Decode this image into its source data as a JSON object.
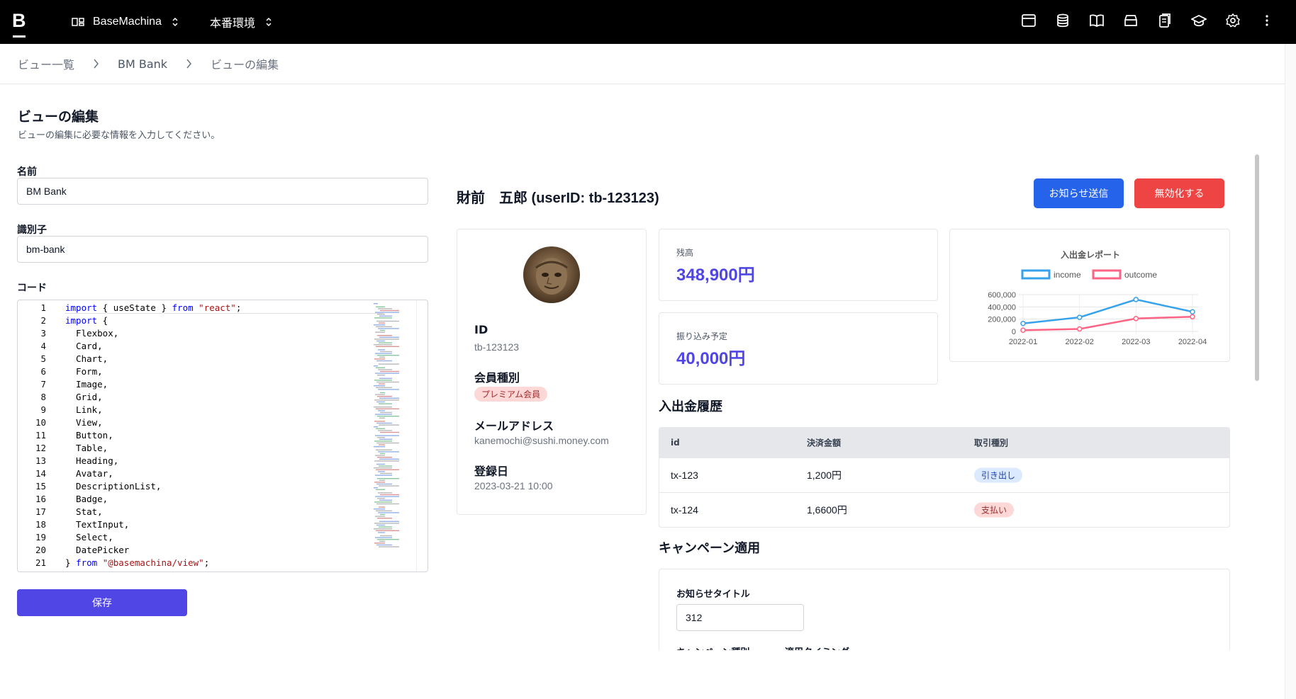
{
  "topbar": {
    "logo": "B",
    "workspace": "BaseMachina",
    "environment": "本番環境",
    "icons": [
      "window-icon",
      "database-icon",
      "book-icon",
      "archive-icon",
      "clipboard-icon",
      "graduation-cap-icon",
      "gear-icon",
      "more-vertical-icon"
    ]
  },
  "breadcrumb": [
    "ビュー一覧",
    "BM Bank",
    "ビューの編集"
  ],
  "page": {
    "title": "ビューの編集",
    "subtitle": "ビューの編集に必要な情報を入力してください。"
  },
  "form": {
    "name_label": "名前",
    "name_value": "BM Bank",
    "id_label": "識別子",
    "id_value": "bm-bank",
    "code_label": "コード",
    "save_label": "保存"
  },
  "code_lines": [
    "import { useState } from \"react\";",
    "import {",
    "  Flexbox,",
    "  Card,",
    "  Chart,",
    "  Form,",
    "  Image,",
    "  Grid,",
    "  Link,",
    "  View,",
    "  Button,",
    "  Table,",
    "  Heading,",
    "  Avatar,",
    "  DescriptionList,",
    "  Badge,",
    "  Stat,",
    "  TextInput,",
    "  Select,",
    "  DatePicker",
    "} from \"@basemachina/view\";"
  ],
  "preview": {
    "user_title": "財前　五郎 (userID: tb-123123)",
    "notify_button": "お知らせ送信",
    "disable_button": "無効化する",
    "profile": {
      "id_label": "ID",
      "id_value": "tb-123123",
      "member_label": "会員種別",
      "member_badge": "プレミアム会員",
      "email_label": "メールアドレス",
      "email_value": "kanemochi@sushi.money.com",
      "registered_label": "登録日",
      "registered_value": "2023-03-21 10:00"
    },
    "balance": {
      "label": "残高",
      "value": "348,900円"
    },
    "transfer": {
      "label": "振り込み予定",
      "value": "40,000円"
    },
    "history_title": "入出金履歴",
    "table": {
      "headers": [
        "id",
        "決済金額",
        "取引種別"
      ],
      "rows": [
        {
          "id": "tx-123",
          "amount": "1,200円",
          "type": "引き出し"
        },
        {
          "id": "tx-124",
          "amount": "1,6600円",
          "type": "支払い"
        }
      ]
    },
    "campaign": {
      "title": "キャンペーン適用",
      "notice_title_label": "お知らせタイトル",
      "notice_title_value": "312",
      "campaign_type_label": "キャンペーン種別",
      "timing_label": "適用タイミング"
    }
  },
  "colors": {
    "accent": "#4f46e5",
    "notify": "#2563eb",
    "danger": "#ef4444",
    "income": "#36a2eb",
    "outcome": "#ff6384"
  },
  "chart_data": {
    "type": "line",
    "title": "入出金レポート",
    "categories": [
      "2022-01",
      "2022-02",
      "2022-03",
      "2022-04"
    ],
    "series": [
      {
        "name": "income",
        "values": [
          130000,
          230000,
          520000,
          320000
        ],
        "color": "#36a2eb"
      },
      {
        "name": "outcome",
        "values": [
          20000,
          40000,
          210000,
          240000
        ],
        "color": "#ff6384"
      }
    ],
    "yticks": [
      "600,000",
      "400,000",
      "200,000",
      "0"
    ],
    "ylim": [
      0,
      600000
    ],
    "legend": "top"
  }
}
